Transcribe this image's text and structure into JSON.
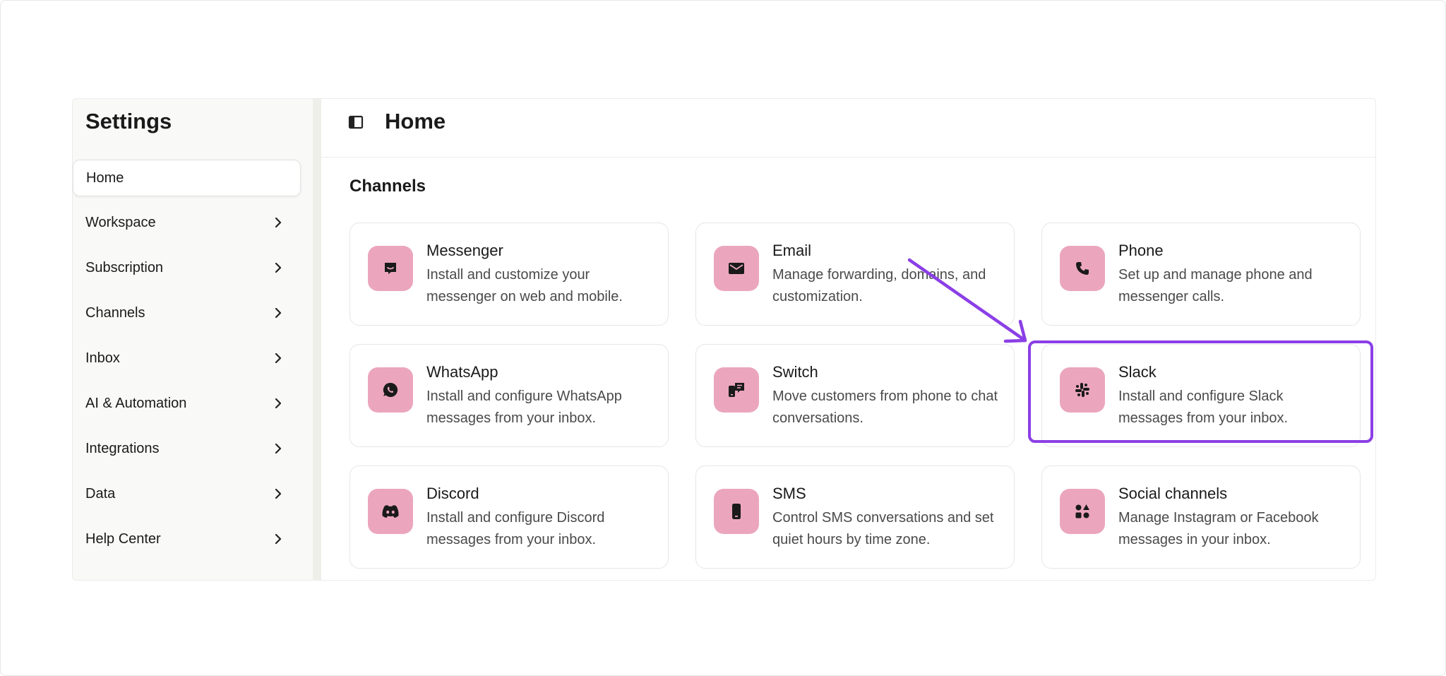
{
  "sidebar": {
    "title": "Settings",
    "items": [
      {
        "label": "Home",
        "active": true
      },
      {
        "label": "Workspace"
      },
      {
        "label": "Subscription"
      },
      {
        "label": "Channels"
      },
      {
        "label": "Inbox"
      },
      {
        "label": "AI & Automation"
      },
      {
        "label": "Integrations"
      },
      {
        "label": "Data"
      },
      {
        "label": "Help Center"
      }
    ]
  },
  "header": {
    "title": "Home",
    "panel_icon": "sidebar-toggle-icon"
  },
  "main": {
    "section_title": "Channels",
    "cards": [
      {
        "title": "Messenger",
        "desc": "Install and customize your messenger on web and mobile.",
        "icon": "messenger-icon"
      },
      {
        "title": "Email",
        "desc": "Manage forwarding, domains, and customization.",
        "icon": "email-icon"
      },
      {
        "title": "Phone",
        "desc": "Set up and manage phone and messenger calls.",
        "icon": "phone-icon"
      },
      {
        "title": "WhatsApp",
        "desc": "Install and configure WhatsApp messages from your inbox.",
        "icon": "whatsapp-icon"
      },
      {
        "title": "Switch",
        "desc": "Move customers from phone to chat conversations.",
        "icon": "switch-icon"
      },
      {
        "title": "Slack",
        "desc": "Install and configure Slack messages from your inbox.",
        "icon": "slack-icon"
      },
      {
        "title": "Discord",
        "desc": "Install and configure Discord messages from your inbox.",
        "icon": "discord-icon"
      },
      {
        "title": "SMS",
        "desc": "Control SMS conversations and set quiet hours by time zone.",
        "icon": "sms-icon"
      },
      {
        "title": "Social channels",
        "desc": "Manage Instagram or Facebook messages in your inbox.",
        "icon": "social-channels-icon"
      }
    ]
  },
  "colors": {
    "icon_tile": "#eba6bd",
    "highlight": "#8b3fe6",
    "sidebar_bg": "#f9f9f8"
  }
}
